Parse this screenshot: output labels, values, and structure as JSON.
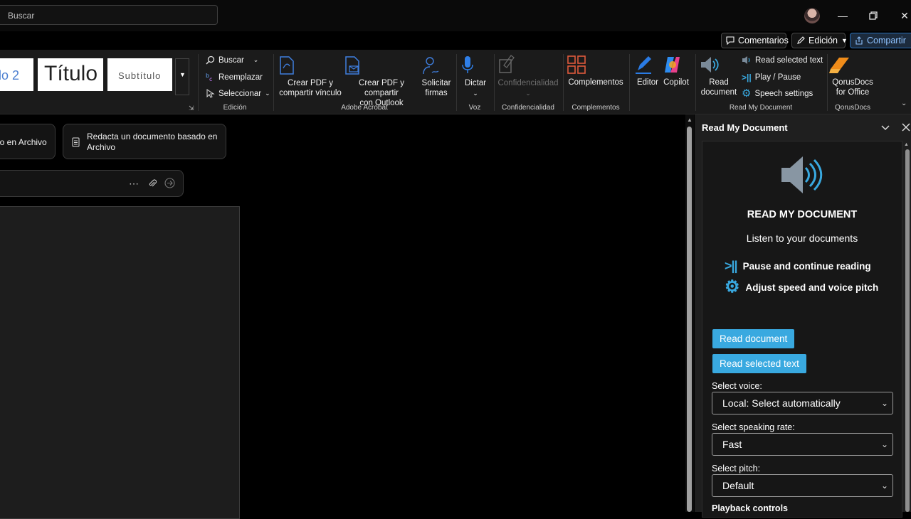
{
  "titlebar": {
    "search_placeholder": "Buscar",
    "window_controls": [
      "minimize-icon",
      "restore-icon",
      "close-icon"
    ]
  },
  "actions": {
    "comments": "Comentarios",
    "editing": "Edición",
    "share": "Compartir"
  },
  "ribbon": {
    "styles": {
      "card1": "lo 2",
      "card2": "Título",
      "card3": "Subtítulo"
    },
    "edicion": {
      "find": "Buscar",
      "replace": "Reemplazar",
      "select": "Seleccionar",
      "label": "Edición"
    },
    "acrobat": {
      "btn1": [
        "Crear PDF y",
        "compartir vínculo"
      ],
      "btn2": [
        "Crear PDF y compartir",
        "con Outlook"
      ],
      "btn3": [
        "Solicitar",
        "firmas"
      ],
      "label": "Adobe Acrobat"
    },
    "voz": {
      "dictate": "Dictar",
      "label": "Voz"
    },
    "confidencialidad": {
      "btn": "Confidencialidad",
      "label": "Confidencialidad"
    },
    "complementos": {
      "btn": "Complementos",
      "label": "Complementos"
    },
    "editor": "Editor",
    "copilot": "Copilot",
    "rmd": {
      "read_document": [
        "Read",
        "document"
      ],
      "read_selected": "Read selected text",
      "play_pause": "Play / Pause",
      "speech_settings": "Speech settings",
      "label": "Read My Document"
    },
    "qorus": {
      "btn": [
        "QorusDocs",
        "for Office"
      ],
      "label": "QorusDocs"
    }
  },
  "document": {
    "chip1": "lo en Archivo",
    "chip2": [
      "Redacta un documento basado en",
      "Archivo"
    ]
  },
  "pane": {
    "title": "Read My Document",
    "heading": "READ MY DOCUMENT",
    "subheading": "Listen to your documents",
    "feature1": "Pause and continue reading",
    "feature2": "Adjust speed and voice pitch",
    "btn_read_document": "Read document",
    "btn_read_selected": "Read selected text",
    "voice_label": "Select voice:",
    "voice_value": "Local: Select automatically",
    "rate_label": "Select speaking rate:",
    "rate_value": "Fast",
    "pitch_label": "Select pitch:",
    "pitch_value": "Default",
    "playback_label": "Playback controls"
  },
  "colors": {
    "accent": "#39a9e0",
    "ribbon_bg": "#1b1b1b",
    "pane_bg": "#1f1f1f"
  }
}
